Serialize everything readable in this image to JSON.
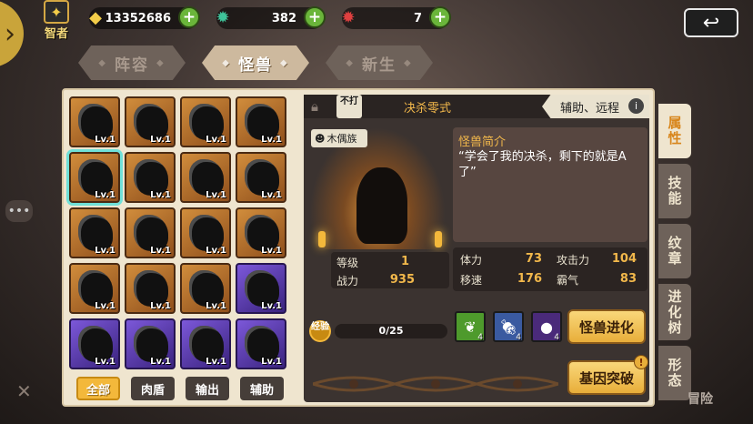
{
  "top": {
    "sage_label": "智者",
    "gold": "13352686",
    "gems": "382",
    "tickets": "7",
    "plus": "+"
  },
  "tabs": [
    "阵容",
    "怪兽",
    "新生"
  ],
  "active_tab": 1,
  "monster": {
    "name": "决杀零式",
    "no_attack_label": "不打",
    "roles": "辅助、远程",
    "tribe": "木偶族",
    "desc_title": "怪兽简介",
    "desc_text": "“学会了我的决杀，剩下的就是A了”",
    "level_label": "等级",
    "level": "1",
    "power_label": "战力",
    "power": "935",
    "stats": [
      {
        "label": "体力",
        "value": "73"
      },
      {
        "label": "攻击力",
        "value": "104"
      },
      {
        "label": "移速",
        "value": "176"
      },
      {
        "label": "霸气",
        "value": "83"
      }
    ],
    "xp_label": "经验",
    "xp": "0/25",
    "xp_fraction": 0
  },
  "items": [
    {
      "icon": "herb-icon",
      "count": "4",
      "color": "#4e9a2c"
    },
    {
      "icon": "meat-icon",
      "count": "4",
      "color": "#3a5aa0"
    },
    {
      "icon": "liver-icon",
      "count": "4",
      "color": "#4a2a7a"
    }
  ],
  "buttons": {
    "evolve": "怪兽进化",
    "gene": "基因突破",
    "gene_alert": "!"
  },
  "grid": {
    "level_label": "Lv.1",
    "cells": [
      "orange",
      "orange",
      "orange",
      "orange",
      "orange",
      "orange",
      "orange",
      "orange",
      "orange",
      "orange",
      "orange",
      "orange",
      "orange",
      "orange",
      "orange",
      "purple",
      "purple",
      "purple",
      "purple",
      "purple"
    ],
    "selected_index": 4
  },
  "filters": [
    "全部",
    "肉盾",
    "输出",
    "辅助"
  ],
  "active_filter": 0,
  "side_tabs": [
    "属性",
    "技能",
    "纹章",
    "进化树",
    "形态"
  ],
  "active_side_tab": 0,
  "bottom": {
    "adventure": "冒险"
  }
}
